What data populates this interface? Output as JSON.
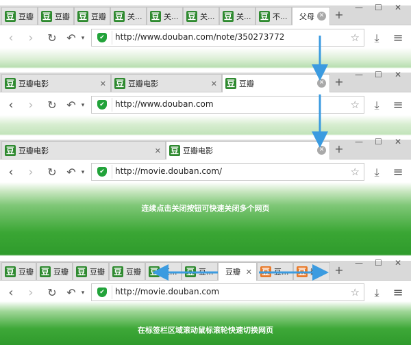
{
  "panels": [
    {
      "tabs": [
        {
          "label": "豆瓣",
          "icon": "douban-icon"
        },
        {
          "label": "豆瓣",
          "icon": "douban-icon"
        },
        {
          "label": "豆瓣",
          "icon": "douban-icon"
        },
        {
          "label": "关...",
          "icon": "douban-icon"
        },
        {
          "label": "关...",
          "icon": "douban-icon"
        },
        {
          "label": "关...",
          "icon": "douban-icon"
        },
        {
          "label": "关...",
          "icon": "douban-icon"
        },
        {
          "label": "不...",
          "icon": "douban-icon"
        },
        {
          "label": "父母",
          "icon": "douban-icon"
        }
      ],
      "url": "http://www.douban.com/note/350273772"
    },
    {
      "tabs": [
        {
          "label": "豆瓣电影",
          "icon": "douban-icon"
        },
        {
          "label": "豆瓣电影",
          "icon": "douban-icon"
        },
        {
          "label": "豆瓣",
          "icon": "douban-icon"
        }
      ],
      "url": "http://www.douban.com"
    },
    {
      "tabs": [
        {
          "label": "豆瓣电影",
          "icon": "douban-icon"
        },
        {
          "label": "豆瓣电影",
          "icon": "douban-icon"
        }
      ],
      "url": "http://movie.douban.com/"
    },
    {
      "tabs": [
        {
          "label": "豆瓣",
          "icon": "douban-icon"
        },
        {
          "label": "豆瓣",
          "icon": "douban-icon"
        },
        {
          "label": "豆瓣",
          "icon": "douban-icon"
        },
        {
          "label": "豆瓣",
          "icon": "douban-icon"
        },
        {
          "label": "豆...",
          "icon": "douban-icon"
        },
        {
          "label": "豆...",
          "icon": "douban-icon"
        },
        {
          "label": "豆瓣",
          "icon": "douban-icon"
        },
        {
          "label": "豆...",
          "icon": "orange-icon"
        },
        {
          "label": "数...",
          "icon": "orange-icon"
        }
      ],
      "url": "http://movie.douban.com"
    }
  ],
  "captions": {
    "close_tip": "连续点击关闭按钮可快速关闭多个网页",
    "scroll_tip": "在标签栏区域滚动鼠标滚轮快速切换网页"
  },
  "glyphs": {
    "fav": "豆",
    "close": "✕",
    "newtab": "+",
    "minimize": "—",
    "maximize": "☐",
    "winclose": "✕",
    "back": "‹",
    "forward": "›",
    "reload": "↻",
    "undo": "↶",
    "undo_menu": "▾",
    "shield": "✔",
    "star": "☆",
    "download": "⤓",
    "menu": "≡"
  },
  "colors": {
    "accent": "#35a52f",
    "arrow": "#3b9be0"
  }
}
